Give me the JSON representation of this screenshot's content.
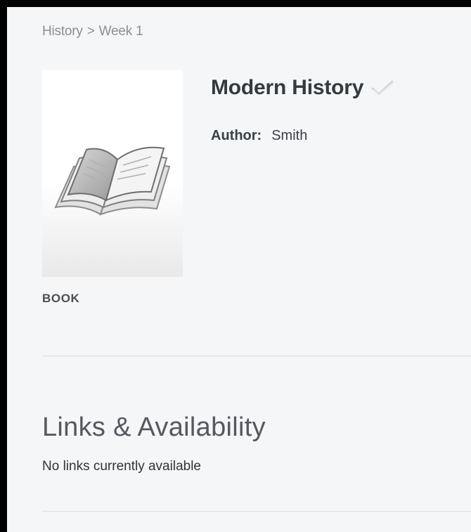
{
  "breadcrumb": {
    "items": [
      "History",
      "Week 1"
    ],
    "separator": ">"
  },
  "record": {
    "title": "Modern History",
    "type_label": "BOOK",
    "author_label": "Author:",
    "author_value": "Smith",
    "thumbnail_icon": "open-book-icon",
    "status_icon": "checkmark-icon"
  },
  "links_section": {
    "heading": "Links & Availability",
    "empty_message": "No links currently available"
  },
  "colors": {
    "frame_border": "#000000",
    "background": "#f4f6f8",
    "breadcrumb_text": "#8a8f95",
    "title_text": "#333a40",
    "divider": "#d8dde2"
  }
}
